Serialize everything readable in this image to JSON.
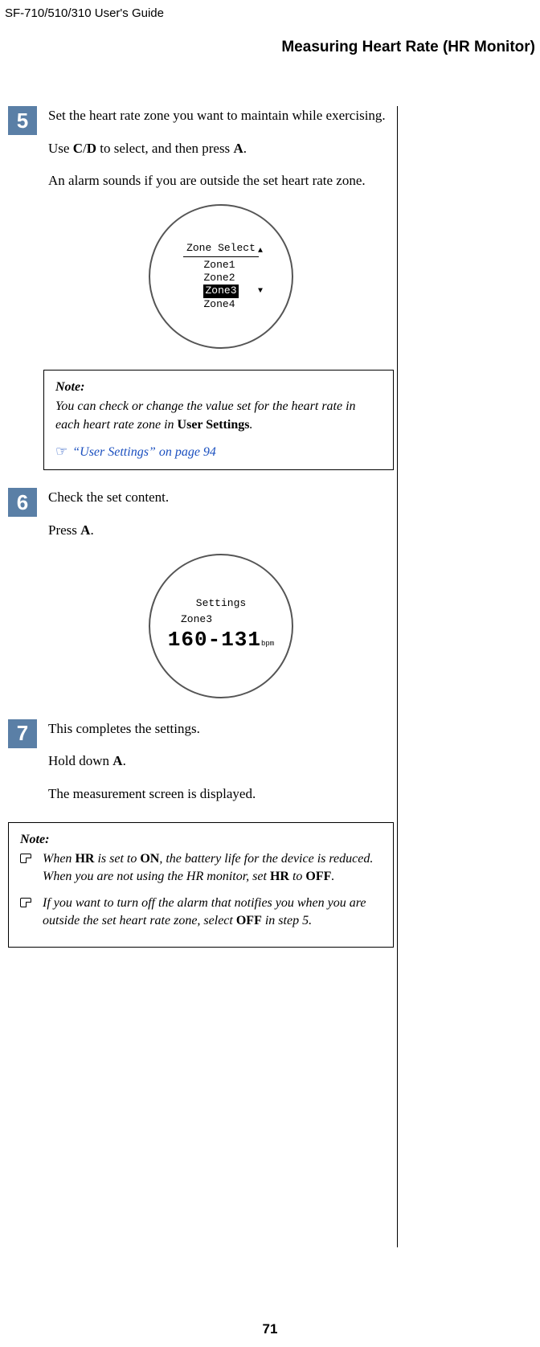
{
  "header": {
    "left": "SF-710/510/310     User's Guide",
    "right": "Measuring Heart Rate (HR Monitor)"
  },
  "step5": {
    "num": "5",
    "p1a": "Set the heart rate zone you want to maintain while exercising.",
    "p2a": "Use ",
    "p2b": "C",
    "p2c": "/",
    "p2d": "D",
    "p2e": " to select, and then press ",
    "p2f": "A",
    "p2g": ".",
    "p3": "An alarm sounds if you are outside the set heart rate zone.",
    "watch_title": "Zone Select",
    "z1": "Zone1",
    "z2": "Zone2",
    "z3": "Zone3",
    "z4": "Zone4"
  },
  "note1": {
    "head": "Note:",
    "body_a": "You can check or change the value set for the heart rate in each heart rate zone in ",
    "body_b": "User Settings",
    "body_c": ".",
    "link": "“User Settings” on page 94",
    "hand": "☞"
  },
  "step6": {
    "num": "6",
    "p1": "Check the set content.",
    "p2a": "Press ",
    "p2b": "A",
    "p2c": ".",
    "watch_title": "Settings",
    "watch_line2": "Zone3",
    "watch_big": "160-131",
    "watch_bpm": "bpm"
  },
  "step7": {
    "num": "7",
    "p1": "This completes the settings.",
    "p2a": "Hold down ",
    "p2b": "A",
    "p2c": ".",
    "p3": "The measurement screen is displayed."
  },
  "note2": {
    "head": "Note:",
    "li1a": "When ",
    "li1b": "HR",
    "li1c": " is set to ",
    "li1d": "ON",
    "li1e": ", the battery life for the device is reduced. When you are not using the HR monitor, set ",
    "li1f": "HR",
    "li1g": " to ",
    "li1h": "OFF",
    "li1i": ".",
    "li2a": "If you want to turn off the alarm that notifies you when you are outside the set heart rate zone, select ",
    "li2b": "OFF",
    "li2c": " in step 5."
  },
  "page_num": "71"
}
